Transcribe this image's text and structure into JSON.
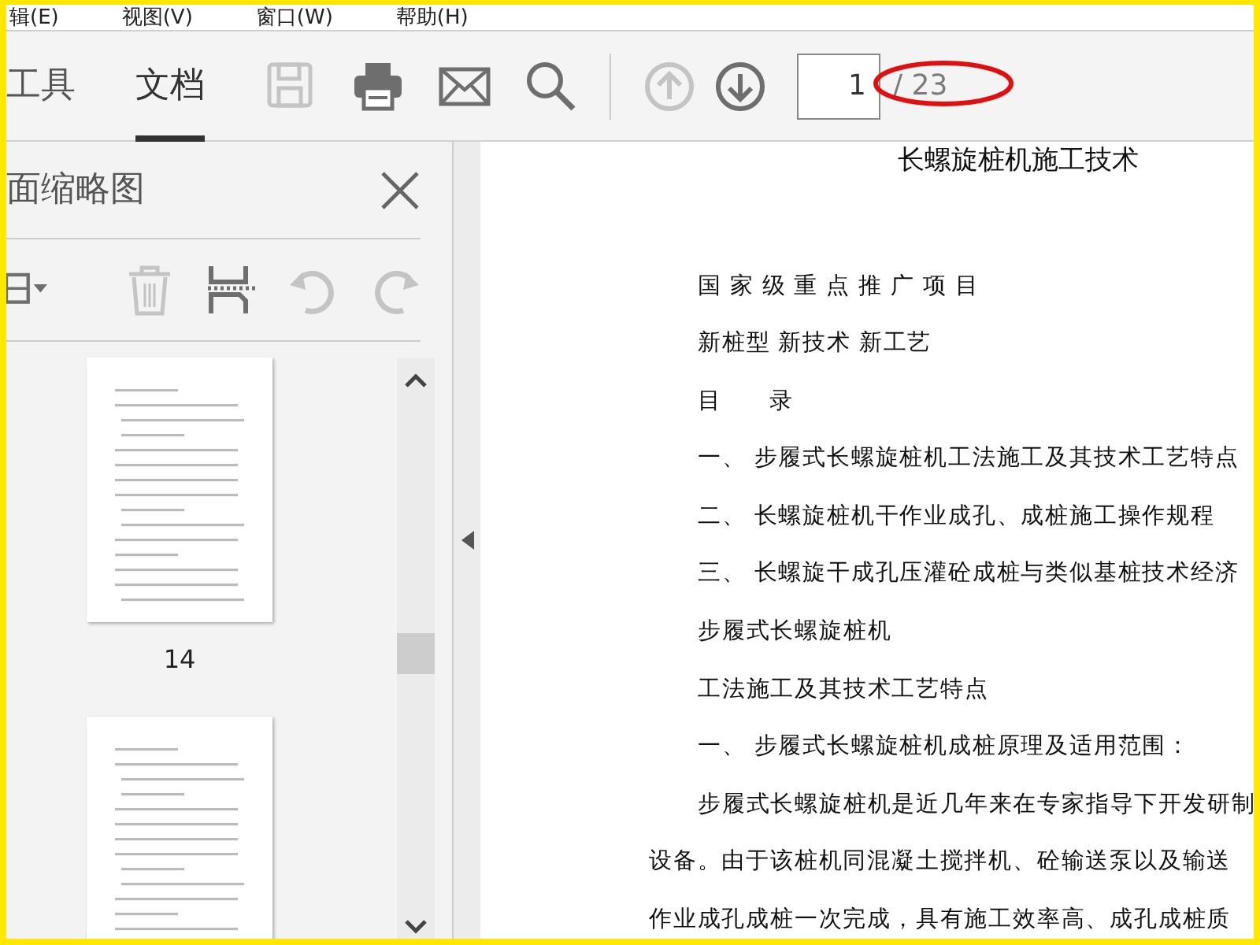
{
  "menu": [
    "辑(E)",
    "视图(V)",
    "窗口(W)",
    "帮助(H)"
  ],
  "tabs": [
    {
      "label": "工具",
      "selected": false
    },
    {
      "label": "文档",
      "selected": true
    }
  ],
  "toolbar": [
    {
      "kind": "save",
      "disabled": true
    },
    {
      "kind": "print",
      "disabled": false
    },
    {
      "kind": "email",
      "disabled": false
    },
    {
      "kind": "search",
      "disabled": false
    }
  ],
  "page_nav": [
    {
      "kind": "up",
      "disabled": true
    },
    {
      "kind": "down",
      "disabled": false
    }
  ],
  "page_field": {
    "value": "1",
    "total": "/ 23"
  },
  "sidebar": {
    "title": "面缩略图",
    "tools": [
      {
        "kind": "options",
        "disabled": false
      },
      {
        "kind": "delete",
        "disabled": true
      },
      {
        "kind": "extract",
        "disabled": false
      },
      {
        "kind": "rotate-left",
        "disabled": true
      },
      {
        "kind": "rotate-right",
        "disabled": true
      }
    ],
    "thumbnails": [
      {
        "label": "14",
        "partial": false
      },
      {
        "partial": true
      }
    ]
  },
  "document": {
    "title": "长螺旋桩机施工技术",
    "lines": [
      {
        "kind": "line",
        "text": "国 家 级 重 点 推 广 项 目"
      },
      {
        "kind": "line",
        "text": "新桩型 新技术 新工艺"
      },
      {
        "kind": "line",
        "text": "目      录"
      },
      {
        "kind": "line",
        "text": "一、 步履式长螺旋桩机工法施工及其技术工艺特点"
      },
      {
        "kind": "line",
        "text": "二、 长螺旋桩机干作业成孔、成桩施工操作规程"
      },
      {
        "kind": "line",
        "text": "三、 长螺旋干成孔压灌砼成桩与类似基桩技术经济"
      },
      {
        "kind": "line",
        "text": "步履式长螺旋桩机"
      },
      {
        "kind": "line",
        "text": "工法施工及其技术工艺特点"
      },
      {
        "kind": "line",
        "text": "一、 步履式长螺旋桩机成桩原理及适用范围："
      },
      {
        "kind": "line",
        "text": "步履式长螺旋桩机是近几年来在专家指导下开发研制"
      },
      {
        "kind": "continuation",
        "text": "设备。由于该桩机同混凝土搅拌机、砼输送泵以及输送"
      },
      {
        "kind": "continuation",
        "text": "作业成孔成桩一次完成，具有施工效率高、成孔成桩质"
      }
    ]
  }
}
